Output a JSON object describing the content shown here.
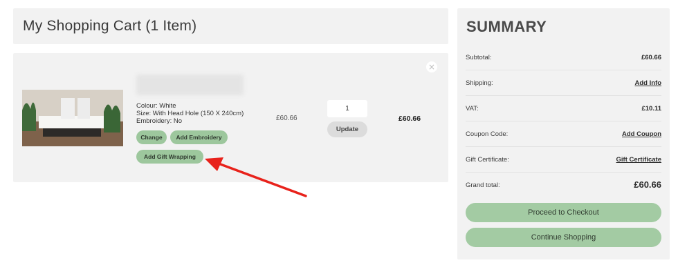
{
  "cart": {
    "title": "My Shopping Cart (1 Item)",
    "remove_icon": "×",
    "item": {
      "options": [
        "Colour: White",
        "Size: With Head Hole (150 X 240cm)",
        "Embroidery: No"
      ],
      "buttons": {
        "change": "Change",
        "add_embroidery": "Add Embroidery",
        "add_gift_wrapping": "Add Gift Wrapping"
      },
      "unit_price": "£60.66",
      "quantity": "1",
      "update_label": "Update",
      "row_total": "£60.66"
    }
  },
  "summary": {
    "title": "SUMMARY",
    "rows": [
      {
        "label": "Subtotal:",
        "value": "£60.66"
      },
      {
        "label": "Shipping:",
        "value": "Add Info"
      },
      {
        "label": "VAT:",
        "value": "£10.11"
      },
      {
        "label": "Coupon Code:",
        "value": "Add Coupon"
      },
      {
        "label": "Gift Certificate:",
        "value": "Gift Certificate"
      },
      {
        "label": "Grand total:",
        "value": "£60.66"
      }
    ],
    "checkout_label": "Proceed to Checkout",
    "continue_label": "Continue Shopping"
  },
  "colors": {
    "panel": "#f2f2f2",
    "accent_green": "#a3cba3",
    "annotation_red": "#e8221b"
  }
}
